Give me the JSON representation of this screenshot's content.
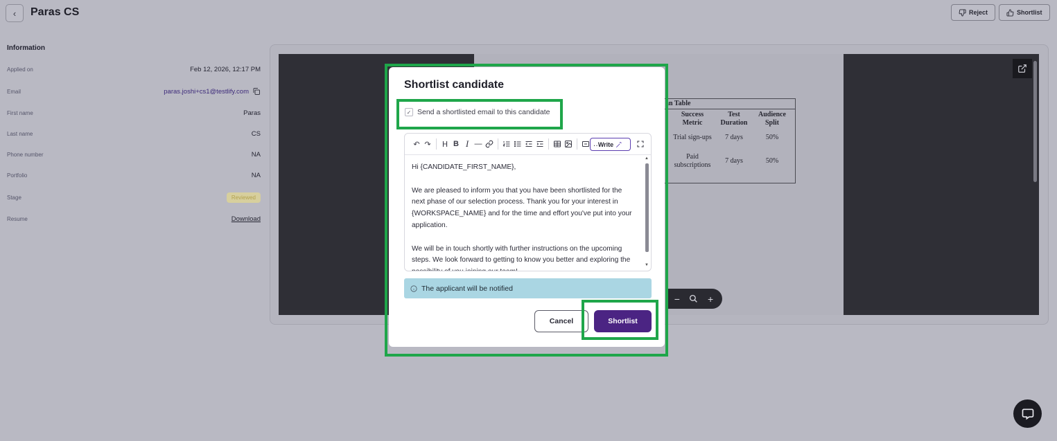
{
  "header": {
    "back_icon": "chevron-left-icon",
    "title": "Paras CS",
    "reject_label": "Reject",
    "shortlist_label": "Shortlist"
  },
  "info": {
    "heading": "Information",
    "rows": [
      {
        "label": "Applied on",
        "value": "Feb 12, 2026, 12:17 PM"
      },
      {
        "label": "Email",
        "value": "paras.joshi+cs1@testlify.com"
      },
      {
        "label": "First name",
        "value": "Paras"
      },
      {
        "label": "Last name",
        "value": "CS"
      },
      {
        "label": "Phone number",
        "value": "NA"
      },
      {
        "label": "Portfolio",
        "value": "NA"
      },
      {
        "label": "Stage",
        "value": "Reviewed"
      },
      {
        "label": "Resume",
        "value": "Download"
      }
    ]
  },
  "preview": {
    "table_caption": "an Table",
    "headers": [
      "Success Metric",
      "Test Duration",
      "Audience Split"
    ],
    "rows": [
      [
        "Trial sign-ups",
        "7 days",
        "50%"
      ],
      [
        "Paid subscriptions",
        "7 days",
        "50%"
      ]
    ]
  },
  "modal": {
    "title": "Shortlist candidate",
    "checkbox_label": "Send a shortlisted email to this candidate",
    "checkbox_checked": true,
    "write_label": "Write",
    "email_body": [
      "Hi {CANDIDATE_FIRST_NAME},",
      "We are pleased to inform you that you have been shortlisted for the next phase of our selection process. Thank you for your interest in {WORKSPACE_NAME} and for the time and effort you've put into your application.",
      "We will be in touch shortly with further instructions on the upcoming steps. We look forward to getting to know you better and exploring the possibility of you joining our team!"
    ],
    "notice": "The applicant will be notified",
    "cancel_label": "Cancel",
    "shortlist_label": "Shortlist"
  },
  "colors": {
    "highlight": "#1fa64a",
    "primary": "#4b2483",
    "notice_bg": "#aad6e3"
  }
}
